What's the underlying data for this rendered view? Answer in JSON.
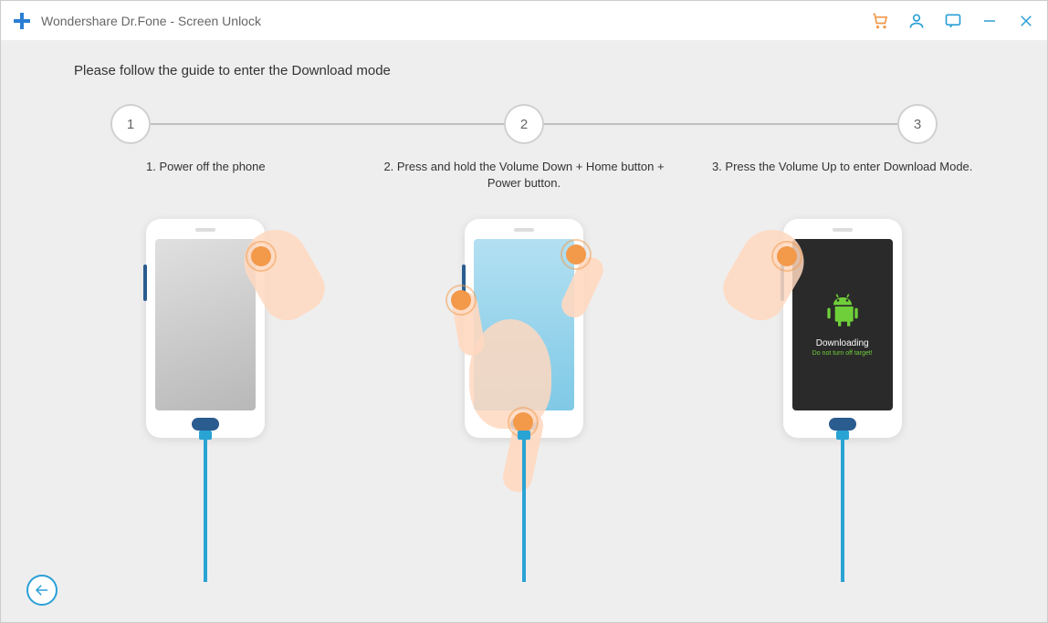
{
  "app": {
    "title": "Wondershare Dr.Fone - Screen Unlock"
  },
  "guide": {
    "title": "Please follow the guide to enter the Download mode"
  },
  "stepper": {
    "s1": "1",
    "s2": "2",
    "s3": "3"
  },
  "steps": {
    "step1": {
      "label": "1. Power off the phone"
    },
    "step2": {
      "label": "2. Press and hold the Volume Down + Home button + Power button."
    },
    "step3": {
      "label": "3. Press the Volume Up to enter Download Mode.",
      "screen_text": "Downloading",
      "screen_sub": "Do not turn off target!"
    }
  },
  "colors": {
    "accent": "#2a9fd6",
    "orange": "#f2994a"
  }
}
